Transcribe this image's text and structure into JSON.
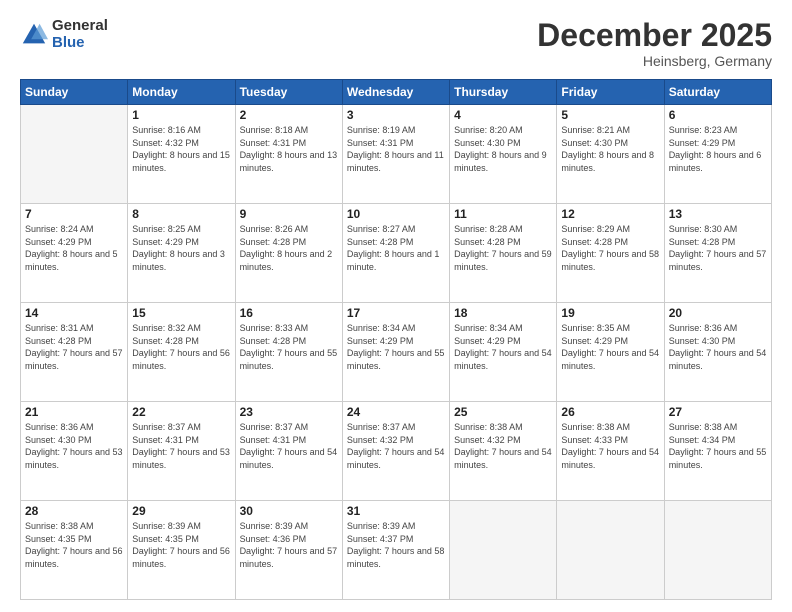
{
  "logo": {
    "general": "General",
    "blue": "Blue"
  },
  "title": "December 2025",
  "location": "Heinsberg, Germany",
  "days_header": [
    "Sunday",
    "Monday",
    "Tuesday",
    "Wednesday",
    "Thursday",
    "Friday",
    "Saturday"
  ],
  "weeks": [
    [
      {
        "num": "",
        "empty": true
      },
      {
        "num": "1",
        "sunrise": "8:16 AM",
        "sunset": "4:32 PM",
        "daylight": "8 hours and 15 minutes."
      },
      {
        "num": "2",
        "sunrise": "8:18 AM",
        "sunset": "4:31 PM",
        "daylight": "8 hours and 13 minutes."
      },
      {
        "num": "3",
        "sunrise": "8:19 AM",
        "sunset": "4:31 PM",
        "daylight": "8 hours and 11 minutes."
      },
      {
        "num": "4",
        "sunrise": "8:20 AM",
        "sunset": "4:30 PM",
        "daylight": "8 hours and 9 minutes."
      },
      {
        "num": "5",
        "sunrise": "8:21 AM",
        "sunset": "4:30 PM",
        "daylight": "8 hours and 8 minutes."
      },
      {
        "num": "6",
        "sunrise": "8:23 AM",
        "sunset": "4:29 PM",
        "daylight": "8 hours and 6 minutes."
      }
    ],
    [
      {
        "num": "7",
        "sunrise": "8:24 AM",
        "sunset": "4:29 PM",
        "daylight": "8 hours and 5 minutes."
      },
      {
        "num": "8",
        "sunrise": "8:25 AM",
        "sunset": "4:29 PM",
        "daylight": "8 hours and 3 minutes."
      },
      {
        "num": "9",
        "sunrise": "8:26 AM",
        "sunset": "4:28 PM",
        "daylight": "8 hours and 2 minutes."
      },
      {
        "num": "10",
        "sunrise": "8:27 AM",
        "sunset": "4:28 PM",
        "daylight": "8 hours and 1 minute."
      },
      {
        "num": "11",
        "sunrise": "8:28 AM",
        "sunset": "4:28 PM",
        "daylight": "7 hours and 59 minutes."
      },
      {
        "num": "12",
        "sunrise": "8:29 AM",
        "sunset": "4:28 PM",
        "daylight": "7 hours and 58 minutes."
      },
      {
        "num": "13",
        "sunrise": "8:30 AM",
        "sunset": "4:28 PM",
        "daylight": "7 hours and 57 minutes."
      }
    ],
    [
      {
        "num": "14",
        "sunrise": "8:31 AM",
        "sunset": "4:28 PM",
        "daylight": "7 hours and 57 minutes."
      },
      {
        "num": "15",
        "sunrise": "8:32 AM",
        "sunset": "4:28 PM",
        "daylight": "7 hours and 56 minutes."
      },
      {
        "num": "16",
        "sunrise": "8:33 AM",
        "sunset": "4:28 PM",
        "daylight": "7 hours and 55 minutes."
      },
      {
        "num": "17",
        "sunrise": "8:34 AM",
        "sunset": "4:29 PM",
        "daylight": "7 hours and 55 minutes."
      },
      {
        "num": "18",
        "sunrise": "8:34 AM",
        "sunset": "4:29 PM",
        "daylight": "7 hours and 54 minutes."
      },
      {
        "num": "19",
        "sunrise": "8:35 AM",
        "sunset": "4:29 PM",
        "daylight": "7 hours and 54 minutes."
      },
      {
        "num": "20",
        "sunrise": "8:36 AM",
        "sunset": "4:30 PM",
        "daylight": "7 hours and 54 minutes."
      }
    ],
    [
      {
        "num": "21",
        "sunrise": "8:36 AM",
        "sunset": "4:30 PM",
        "daylight": "7 hours and 53 minutes."
      },
      {
        "num": "22",
        "sunrise": "8:37 AM",
        "sunset": "4:31 PM",
        "daylight": "7 hours and 53 minutes."
      },
      {
        "num": "23",
        "sunrise": "8:37 AM",
        "sunset": "4:31 PM",
        "daylight": "7 hours and 54 minutes."
      },
      {
        "num": "24",
        "sunrise": "8:37 AM",
        "sunset": "4:32 PM",
        "daylight": "7 hours and 54 minutes."
      },
      {
        "num": "25",
        "sunrise": "8:38 AM",
        "sunset": "4:32 PM",
        "daylight": "7 hours and 54 minutes."
      },
      {
        "num": "26",
        "sunrise": "8:38 AM",
        "sunset": "4:33 PM",
        "daylight": "7 hours and 54 minutes."
      },
      {
        "num": "27",
        "sunrise": "8:38 AM",
        "sunset": "4:34 PM",
        "daylight": "7 hours and 55 minutes."
      }
    ],
    [
      {
        "num": "28",
        "sunrise": "8:38 AM",
        "sunset": "4:35 PM",
        "daylight": "7 hours and 56 minutes."
      },
      {
        "num": "29",
        "sunrise": "8:39 AM",
        "sunset": "4:35 PM",
        "daylight": "7 hours and 56 minutes."
      },
      {
        "num": "30",
        "sunrise": "8:39 AM",
        "sunset": "4:36 PM",
        "daylight": "7 hours and 57 minutes."
      },
      {
        "num": "31",
        "sunrise": "8:39 AM",
        "sunset": "4:37 PM",
        "daylight": "7 hours and 58 minutes."
      },
      {
        "num": "",
        "empty": true
      },
      {
        "num": "",
        "empty": true
      },
      {
        "num": "",
        "empty": true
      }
    ]
  ]
}
